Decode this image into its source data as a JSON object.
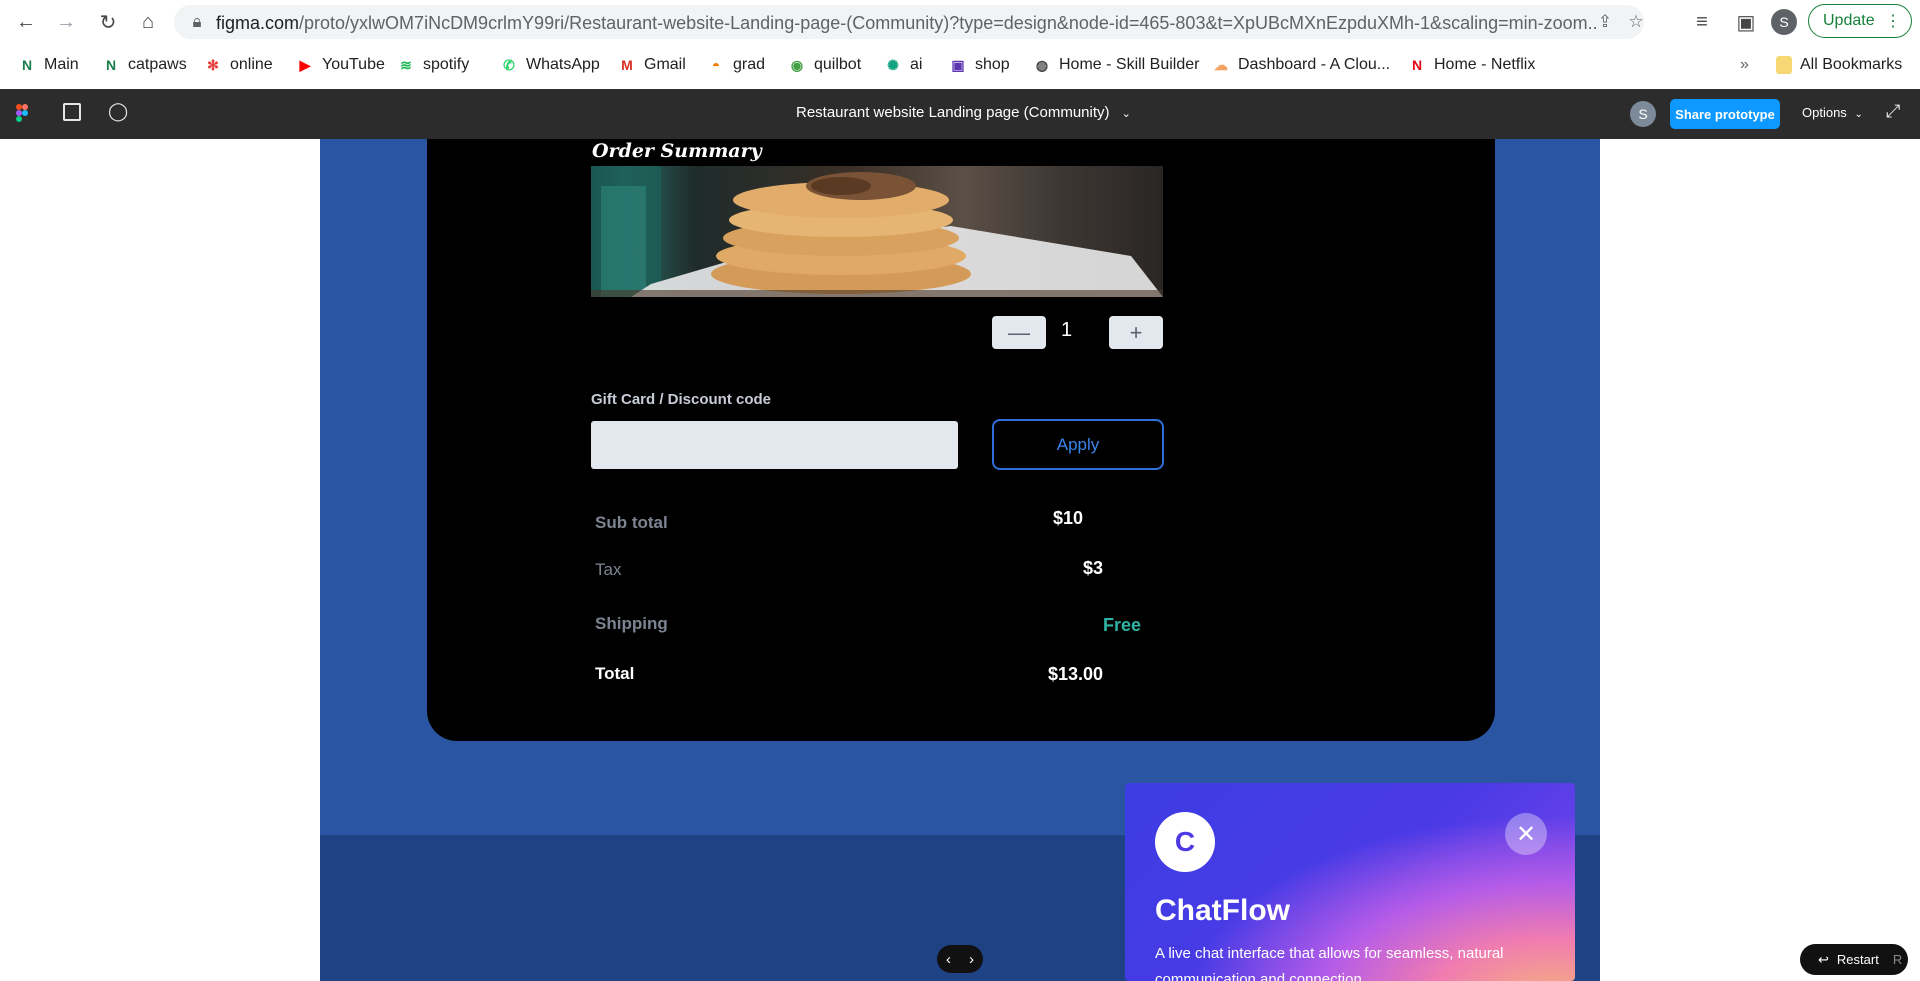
{
  "browser": {
    "url_host": "figma.com",
    "url_rest": "/proto/yxlwOM7iNcDM9crlmY99ri/Restaurant-website-Landing-page-(Community)?type=design&node-id=465-803&t=XpUBcMXnEzpduXMh-1&scaling=min-zoom...",
    "update_label": "Update",
    "profile_initial": "S"
  },
  "bookmarks": [
    {
      "label": "Main",
      "icon": "notion-icon",
      "color": "#1a7f4b",
      "glyph": "N"
    },
    {
      "label": "catpaws",
      "icon": "notion-icon",
      "color": "#1a7f4b",
      "glyph": "N"
    },
    {
      "label": "online",
      "icon": "online-icon",
      "color": "#e53935",
      "glyph": "✻"
    },
    {
      "label": "YouTube",
      "icon": "youtube-icon",
      "color": "#ff0000",
      "glyph": "▶"
    },
    {
      "label": "spotify",
      "icon": "spotify-icon",
      "color": "#1db954",
      "glyph": "≋"
    },
    {
      "label": "WhatsApp",
      "icon": "whatsapp-icon",
      "color": "#25d366",
      "glyph": "✆"
    },
    {
      "label": "Gmail",
      "icon": "gmail-icon",
      "color": "#d93025",
      "glyph": "M"
    },
    {
      "label": "grad",
      "icon": "grad-icon",
      "color": "#f57c00",
      "glyph": "◓"
    },
    {
      "label": "quilbot",
      "icon": "quillbot-icon",
      "color": "#43a047",
      "glyph": "◉"
    },
    {
      "label": "ai",
      "icon": "openai-icon",
      "color": "#10a37f",
      "glyph": "✺"
    },
    {
      "label": "shop",
      "icon": "shop-icon",
      "color": "#5e35b1",
      "glyph": "▣"
    },
    {
      "label": "Home - Skill Builder",
      "icon": "globe-icon",
      "color": "#444444",
      "glyph": "◍"
    },
    {
      "label": "Dashboard - A Clou...",
      "icon": "cloud-icon",
      "color": "#f4a261",
      "glyph": "☁"
    },
    {
      "label": "Home - Netflix",
      "icon": "netflix-icon",
      "color": "#e50914",
      "glyph": "N"
    }
  ],
  "bookmarks_more": "»",
  "all_bookmarks": "All Bookmarks",
  "figma": {
    "title": "Restaurant website Landing page (Community)",
    "avatar_initial": "S",
    "share_label": "Share prototype",
    "options_label": "Options"
  },
  "order": {
    "title": "Order Summary",
    "quantity": "1",
    "discount_label": "Gift Card / Discount code",
    "discount_value": "",
    "apply_label": "Apply",
    "rows": [
      {
        "label": "Sub total",
        "value": "$10"
      },
      {
        "label": "Tax",
        "value": "$3"
      },
      {
        "label": "Shipping",
        "value": "Free"
      },
      {
        "label": "Total",
        "value": "$13.00"
      }
    ],
    "colors": {
      "free": "#2fb3a4",
      "accent": "#3a85ea"
    }
  },
  "chatflow": {
    "avatar_letter": "C",
    "title": "ChatFlow",
    "description": "A live chat interface that allows for seamless, natural communication and connection."
  },
  "restart": {
    "label": "Restart",
    "shortcut": "R"
  }
}
